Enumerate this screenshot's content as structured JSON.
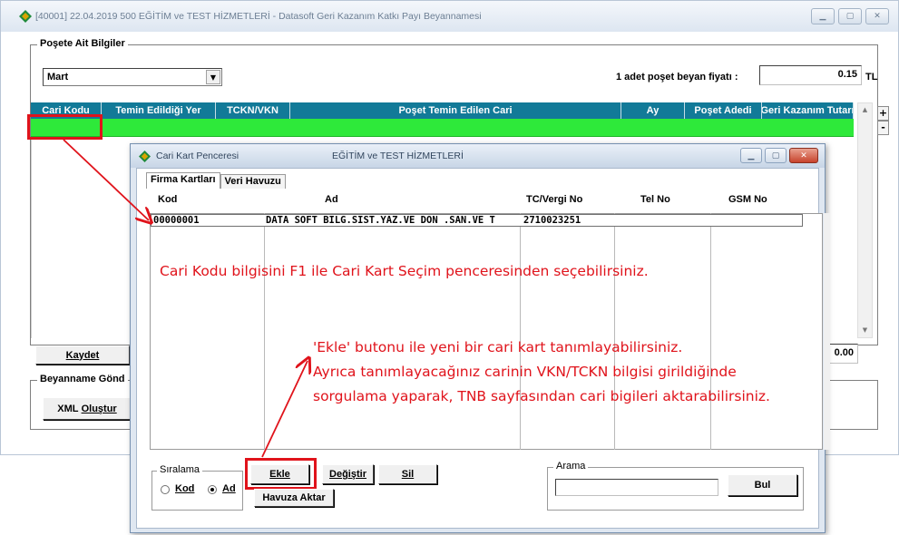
{
  "main": {
    "title": "[40001] 22.04.2019 500  EĞİTİM ve TEST HİZMETLERİ  -  Datasoft Geri Kazanım Katkı Payı Beyannamesi",
    "group_title": "Poşete Ait Bilgiler",
    "month_value": "Mart",
    "price_label": "1 adet poşet beyan fiyatı :",
    "price_value": "0.15",
    "price_unit": "TL",
    "columns": [
      "Cari Kodu",
      "Temin Edildiği Yer",
      "TCKN/VKN",
      "Poşet Temin Edilen Cari",
      "Ay",
      "Poşet Adedi",
      "Geri Kazanım Tutarı"
    ],
    "plus_label": "+",
    "minus_label": "-",
    "save_label": "Kaydet",
    "total_value": "0.00",
    "send_group_title": "Beyanname Gönd",
    "xml_label_u": "XML",
    "xml_label_rest": "Oluştur"
  },
  "dialog": {
    "title": "Cari Kart Penceresi",
    "company": "EĞİTİM ve TEST HİZMETLERİ",
    "tabs": [
      "Firma Kartları",
      "Veri Havuzu"
    ],
    "columns": [
      "Kod",
      "Ad",
      "TC/Vergi No",
      "Tel No",
      "GSM No"
    ],
    "rows": [
      {
        "kod": "00000001",
        "ad": "DATA SOFT BILG.SIST.YAZ.VE DON .SAN.VE T",
        "vergi": "2710023251",
        "tel": "",
        "gsm": ""
      }
    ],
    "sort_group": "Sıralama",
    "sort_kod": "Kod",
    "sort_ad": "Ad",
    "add_label": "Ekle",
    "change_label": "Değiştir",
    "delete_label": "Sil",
    "pool_label": "Havuza Aktar",
    "search_group": "Arama",
    "search_value": "",
    "find_label": "Bul"
  },
  "annotations": {
    "line1": "Cari Kodu bilgisini F1 ile Cari Kart Seçim penceresinden seçebilirsiniz.",
    "line2": "'Ekle' butonu ile yeni bir cari kart tanımlayabilirsiniz.",
    "line3": "Ayrıca tanımlayacağınız carinin VKN/TCKN bilgisi girildiğinde",
    "line4": "sorgulama yaparak, TNB sayfasından cari bigileri aktarabilirsiniz."
  },
  "colors": {
    "grid_header": "#127a98",
    "grid_row": "#2ee93a",
    "annotation_red": "#e0131b"
  },
  "icons": {
    "app": "diamond-logo-icon",
    "minimize": "minimize-icon",
    "maximize": "maximize-icon",
    "close": "close-icon",
    "dropdown": "chevron-down-icon"
  }
}
